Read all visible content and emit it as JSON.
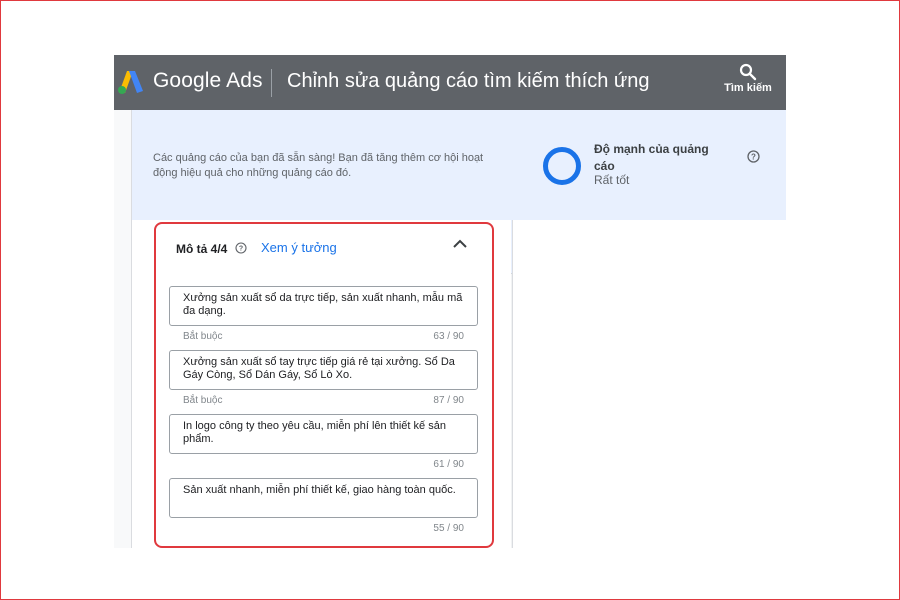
{
  "header": {
    "brand": "Google Ads",
    "page_title": "Chỉnh sửa quảng cáo tìm kiếm thích ứng",
    "search_label": "Tìm kiếm"
  },
  "banner": {
    "message": "Các quảng cáo của bạn đã sẵn sàng! Bạn đã tăng thêm cơ hội hoạt động hiệu quả cho những quảng cáo đó.",
    "strength_title": "Độ mạnh của quảng cáo",
    "strength_value": "Rất tốt"
  },
  "descriptions": {
    "heading": "Mô tả 4/4",
    "ideas_link": "Xem ý tưởng",
    "items": [
      {
        "text": "Xưởng sản xuất sổ da trực tiếp, sản xuất nhanh, mẫu mã đa dạng.",
        "hint": "Bắt buộc",
        "count": "63 / 90"
      },
      {
        "text": "Xưởng sản xuất sổ tay trực tiếp giá rẻ tại xưởng. Sổ Da Gáy Còng, Sổ Dán Gáy, Sổ Lò Xo.",
        "hint": "Bắt buộc",
        "count": "87 / 90"
      },
      {
        "text": "In logo công ty theo yêu cầu, miễn phí lên thiết kế sản phẩm.",
        "hint": "",
        "count": "61 / 90"
      },
      {
        "text": "Sản xuất nhanh, miễn phí thiết kế, giao hàng toàn quốc.",
        "hint": "",
        "count": "55 / 90"
      }
    ]
  },
  "colors": {
    "topbar": "#5f6368",
    "accent": "#1a73e8",
    "highlight_border": "#e0393e",
    "banner_bg": "#e8f0fe"
  },
  "icons": {
    "logo": "google-ads-logo",
    "search": "search-icon",
    "help": "help-circle-icon",
    "collapse": "chevron-up-icon",
    "strength": "ad-strength-ring-icon"
  }
}
